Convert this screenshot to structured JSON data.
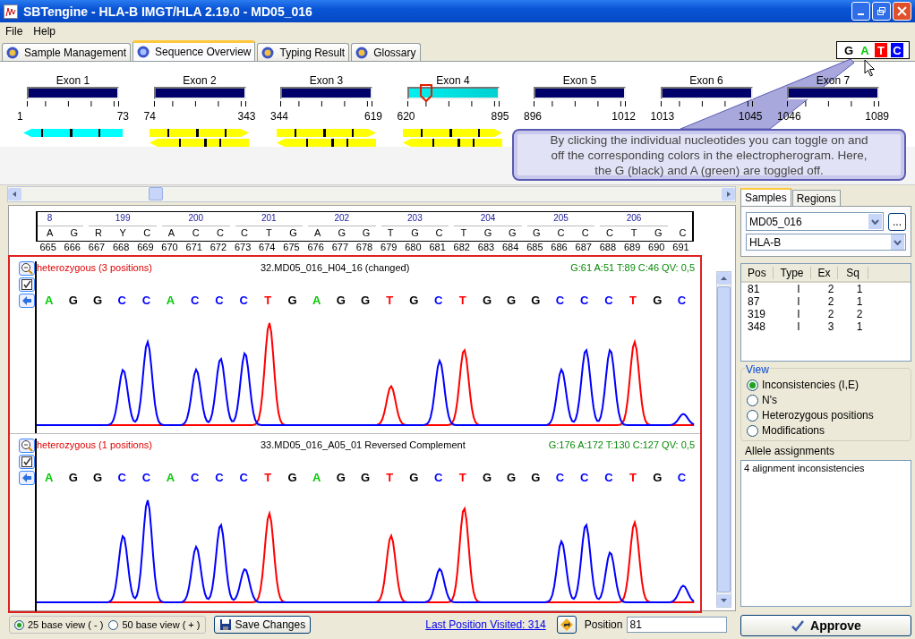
{
  "window": {
    "title": "SBTengine - HLA-B IMGT/HLA 2.19.0 - MD05_016"
  },
  "menu": [
    "File",
    "Help"
  ],
  "tabs": [
    {
      "label": "Sample Management",
      "selected": false
    },
    {
      "label": "Sequence Overview",
      "selected": true
    },
    {
      "label": "Typing Result",
      "selected": false
    },
    {
      "label": "Glossary",
      "selected": false
    }
  ],
  "nucleotide_toggles": [
    {
      "label": "G",
      "color": "#000000",
      "on": false
    },
    {
      "label": "A",
      "color": "#00cc00",
      "on": false
    },
    {
      "label": "T",
      "color": "#ff0000",
      "on": true
    },
    {
      "label": "C",
      "color": "#0000ff",
      "on": true
    }
  ],
  "exons": [
    {
      "label": "Exon 1",
      "start": "1",
      "end": "73",
      "selected": false,
      "reads": [
        {
          "kind": "reverse",
          "color": "#00ffff"
        }
      ]
    },
    {
      "label": "Exon 2",
      "start": "74",
      "end": "343",
      "selected": false,
      "reads": [
        {
          "kind": "forward",
          "color": "#ffff00"
        },
        {
          "kind": "reverse",
          "color": "#ffff00"
        }
      ]
    },
    {
      "label": "Exon 3",
      "start": "344",
      "end": "619",
      "selected": false,
      "reads": [
        {
          "kind": "forward",
          "color": "#ffff00"
        },
        {
          "kind": "reverse",
          "color": "#ffff00"
        }
      ]
    },
    {
      "label": "Exon 4",
      "start": "620",
      "end": "895",
      "selected": true,
      "reads": [
        {
          "kind": "forward",
          "color": "#ffff00"
        },
        {
          "kind": "reverse",
          "color": "#ffff00"
        }
      ]
    },
    {
      "label": "Exon 5",
      "start": "896",
      "end": "1012",
      "selected": false
    },
    {
      "label": "Exon 6",
      "start": "1013",
      "end": "1045",
      "selected": false
    },
    {
      "label": "Exon 7",
      "start": "1046",
      "end": "1089",
      "selected": false
    }
  ],
  "callout": {
    "lines": [
      "By clicking the individual nucleotides you can toggle on and",
      "off the corresponding colors in the electropherogram. Here,",
      "the G (black) and A (green) are toggled off."
    ]
  },
  "ruler": {
    "codons": [
      "8",
      "199",
      "200",
      "201",
      "202",
      "203",
      "204",
      "205",
      "206"
    ],
    "bases": [
      "A",
      "G",
      "R",
      "Y",
      "C",
      "A",
      "C",
      "C",
      "C",
      "T",
      "G",
      "A",
      "G",
      "G",
      "T",
      "G",
      "C",
      "T",
      "G",
      "G",
      "G",
      "C",
      "C",
      "C",
      "T",
      "G",
      "C"
    ],
    "positions": [
      "665",
      "666",
      "667",
      "668",
      "669",
      "670",
      "671",
      "672",
      "673",
      "674",
      "675",
      "676",
      "677",
      "678",
      "679",
      "680",
      "681",
      "682",
      "683",
      "684",
      "685",
      "686",
      "687",
      "688",
      "689",
      "690",
      "691"
    ]
  },
  "traces": [
    {
      "heterozygous": "heterozygous (3 positions)",
      "name": "32.MD05_016_H04_16 (changed)",
      "stats": "G:61 A:51 T:89 C:46 QV: 0,5",
      "bases": [
        {
          "base": "A",
          "color": "#00cc00"
        },
        {
          "base": "G",
          "color": "#000000"
        },
        {
          "base": "G",
          "color": "#000000"
        },
        {
          "base": "C",
          "color": "#0000ff"
        },
        {
          "base": "C",
          "color": "#0000ff"
        },
        {
          "base": "A",
          "color": "#00cc00"
        },
        {
          "base": "C",
          "color": "#0000ff"
        },
        {
          "base": "C",
          "color": "#0000ff"
        },
        {
          "base": "C",
          "color": "#0000ff"
        },
        {
          "base": "T",
          "color": "#ff0000"
        },
        {
          "base": "G",
          "color": "#000000"
        },
        {
          "base": "A",
          "color": "#00cc00"
        },
        {
          "base": "G",
          "color": "#000000"
        },
        {
          "base": "G",
          "color": "#000000"
        },
        {
          "base": "T",
          "color": "#ff0000"
        },
        {
          "base": "G",
          "color": "#000000"
        },
        {
          "base": "C",
          "color": "#0000ff"
        },
        {
          "base": "T",
          "color": "#ff0000"
        },
        {
          "base": "G",
          "color": "#000000"
        },
        {
          "base": "G",
          "color": "#000000"
        },
        {
          "base": "G",
          "color": "#000000"
        },
        {
          "base": "C",
          "color": "#0000ff"
        },
        {
          "base": "C",
          "color": "#0000ff"
        },
        {
          "base": "C",
          "color": "#0000ff"
        },
        {
          "base": "T",
          "color": "#ff0000"
        },
        {
          "base": "G",
          "color": "#000000"
        },
        {
          "base": "C",
          "color": "#0000ff"
        }
      ]
    },
    {
      "heterozygous": "heterozygous (1 positions)",
      "name": "33.MD05_016_A05_01 Reversed Complement",
      "stats": "G:176 A:172 T:130 C:127 QV: 0,5",
      "bases": [
        {
          "base": "A",
          "color": "#00cc00"
        },
        {
          "base": "G",
          "color": "#000000"
        },
        {
          "base": "G",
          "color": "#000000"
        },
        {
          "base": "C",
          "color": "#0000ff"
        },
        {
          "base": "C",
          "color": "#0000ff"
        },
        {
          "base": "A",
          "color": "#00cc00"
        },
        {
          "base": "C",
          "color": "#0000ff"
        },
        {
          "base": "C",
          "color": "#0000ff"
        },
        {
          "base": "C",
          "color": "#0000ff"
        },
        {
          "base": "T",
          "color": "#ff0000"
        },
        {
          "base": "G",
          "color": "#000000"
        },
        {
          "base": "A",
          "color": "#00cc00"
        },
        {
          "base": "G",
          "color": "#000000"
        },
        {
          "base": "G",
          "color": "#000000"
        },
        {
          "base": "T",
          "color": "#ff0000"
        },
        {
          "base": "G",
          "color": "#000000"
        },
        {
          "base": "C",
          "color": "#0000ff"
        },
        {
          "base": "T",
          "color": "#ff0000"
        },
        {
          "base": "G",
          "color": "#000000"
        },
        {
          "base": "G",
          "color": "#000000"
        },
        {
          "base": "G",
          "color": "#000000"
        },
        {
          "base": "C",
          "color": "#0000ff"
        },
        {
          "base": "C",
          "color": "#0000ff"
        },
        {
          "base": "C",
          "color": "#0000ff"
        },
        {
          "base": "T",
          "color": "#ff0000"
        },
        {
          "base": "G",
          "color": "#000000"
        },
        {
          "base": "C",
          "color": "#0000ff"
        }
      ]
    }
  ],
  "side_tabs": [
    {
      "label": "Samples",
      "selected": true
    },
    {
      "label": "Regions",
      "selected": false
    }
  ],
  "sample_select": "MD05_016",
  "browse_button": "...",
  "region_select": "HLA-B",
  "positions_table": {
    "columns": [
      "Pos",
      "Type",
      "Ex",
      "Sq"
    ],
    "rows": [
      [
        "81",
        "I",
        "2",
        "1"
      ],
      [
        "87",
        "I",
        "2",
        "1"
      ],
      [
        "319",
        "I",
        "2",
        "2"
      ],
      [
        "348",
        "I",
        "3",
        "1"
      ]
    ]
  },
  "view": {
    "title": "View",
    "options": [
      {
        "label": "Inconsistencies (I,E)",
        "selected": true
      },
      {
        "label": "N's",
        "selected": false
      },
      {
        "label": "Heterozygous positions",
        "selected": false
      },
      {
        "label": "Modifications",
        "selected": false
      }
    ]
  },
  "allele_assignments": {
    "label": "Allele assignments",
    "text": "4 alignment inconsistencies"
  },
  "bottom": {
    "base_views": [
      {
        "label": "25 base view ( - )",
        "selected": true
      },
      {
        "label": "50 base view ( + )",
        "selected": false
      }
    ],
    "save_button": "Save Changes",
    "last_position_link": "Last Position Visited: 314",
    "position_label": "Position",
    "position_value": "81",
    "approve_button": "Approve"
  }
}
